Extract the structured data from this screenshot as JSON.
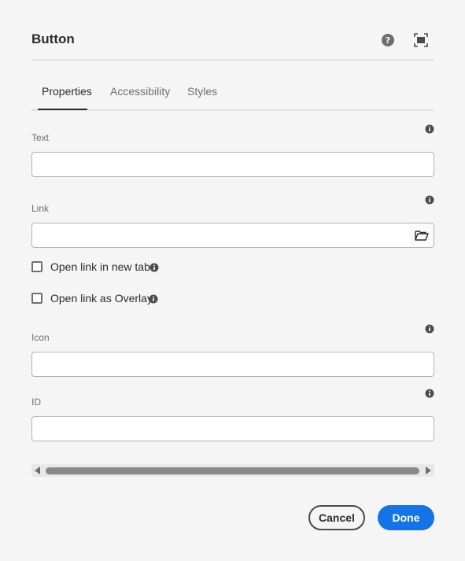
{
  "dialog": {
    "title": "Button",
    "help_icon": "help-icon",
    "fullscreen_icon": "fullscreen-icon"
  },
  "tabs": [
    {
      "label": "Properties",
      "active": true
    },
    {
      "label": "Accessibility",
      "active": false
    },
    {
      "label": "Styles",
      "active": false
    }
  ],
  "fields": {
    "text": {
      "label": "Text",
      "value": "",
      "placeholder": ""
    },
    "link": {
      "label": "Link",
      "value": "",
      "placeholder": "",
      "browse_icon": "folder-open-icon"
    },
    "open_new_tab": {
      "label": "Open link in new tab",
      "checked": false
    },
    "open_overlay": {
      "label": "Open link as Overlay",
      "checked": false
    },
    "icon": {
      "label": "Icon",
      "value": "",
      "placeholder": ""
    },
    "id": {
      "label": "ID",
      "value": "",
      "placeholder": ""
    }
  },
  "footer": {
    "cancel_label": "Cancel",
    "done_label": "Done"
  },
  "colors": {
    "accent": "#1473e6",
    "background": "#f5f5f5"
  }
}
